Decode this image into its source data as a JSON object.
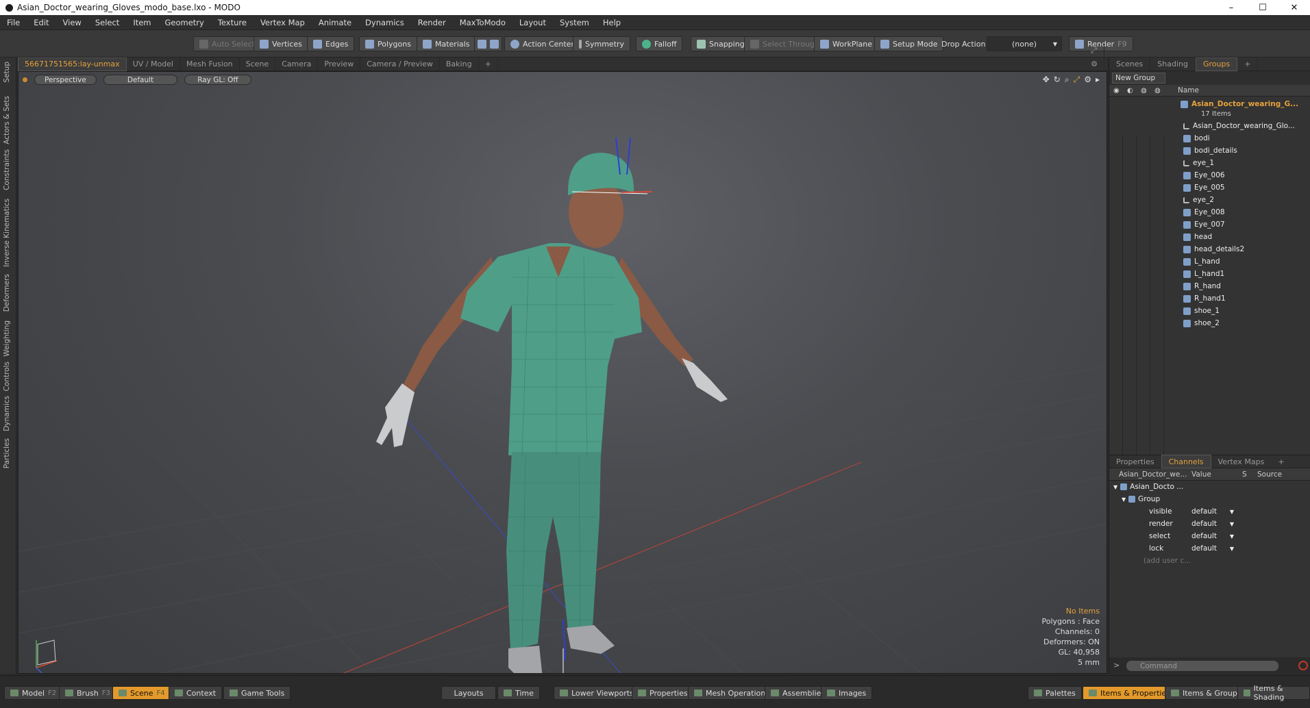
{
  "window": {
    "title": "Asian_Doctor_wearing_Gloves_modo_base.lxo - MODO",
    "min": "–",
    "max": "☐",
    "close": "✕"
  },
  "menu": [
    "File",
    "Edit",
    "View",
    "Select",
    "Item",
    "Geometry",
    "Texture",
    "Vertex Map",
    "Animate",
    "Dynamics",
    "Render",
    "MaxToModo",
    "Layout",
    "System",
    "Help"
  ],
  "toolbar": {
    "auto_select": "Auto Select",
    "vertices": "Vertices",
    "edges": "Edges",
    "polygons": "Polygons",
    "materials": "Materials",
    "action_center": "Action Center",
    "symmetry": "Symmetry",
    "falloff": "Falloff",
    "snapping": "Snapping",
    "select_through": "Select Through",
    "workplane": "WorkPlane",
    "setup_mode": "Setup Mode",
    "drop_action": "Drop Action",
    "drop_value": "(none)",
    "render": "Render",
    "render_key": "F9"
  },
  "left_strip": [
    "Setup",
    "Actors & Sets",
    "Constraints",
    "Inverse Kinematics",
    "Deformers",
    "Weighting",
    "Controls",
    "Dynamics",
    "Particles"
  ],
  "viewport_tabs": [
    "56671751565:lay-unmax",
    "UV / Model",
    "Mesh Fusion",
    "Scene",
    "Camera",
    "Preview",
    "Camera / Preview",
    "Baking",
    "+"
  ],
  "viewport": {
    "view": "Perspective",
    "shading": "Default",
    "raygl": "Ray GL: Off",
    "info": {
      "items": "No Items",
      "polygons": "Polygons : Face",
      "channels": "Channels: 0",
      "deformers": "Deformers: ON",
      "gl": "GL: 40,958",
      "scale": "5 mm"
    }
  },
  "right_tabs": [
    "Scenes",
    "Shading",
    "Groups",
    "+"
  ],
  "groups": {
    "new_group": "New Group",
    "col_name": "Name",
    "root": "Asian_Doctor_wearing_G...",
    "root_count": "17 Items",
    "items": [
      "Asian_Doctor_wearing_Glo...",
      "bodi",
      "bodi_details",
      "eye_1",
      "Eye_006",
      "Eye_005",
      "eye_2",
      "Eye_008",
      "Eye_007",
      "head",
      "head_details2",
      "L_hand",
      "L_hand1",
      "R_hand",
      "R_hand1",
      "shoe_1",
      "shoe_2"
    ]
  },
  "channel_tabs": [
    "Properties",
    "Channels",
    "Vertex Maps",
    "+"
  ],
  "channels": {
    "col_name": "Asian_Doctor_we...",
    "col_value": "Value",
    "col_s": "S",
    "col_source": "Source",
    "item": "Asian_Docto ...",
    "group": "Group",
    "rows": [
      {
        "name": "visible",
        "value": "default"
      },
      {
        "name": "render",
        "value": "default"
      },
      {
        "name": "select",
        "value": "default"
      },
      {
        "name": "lock",
        "value": "default"
      }
    ],
    "add_user": "(add user c..."
  },
  "command_placeholder": "Command",
  "bottom": {
    "model": "Model",
    "model_key": "F2",
    "brush": "Brush",
    "brush_key": "F3",
    "scene": "Scene",
    "scene_key": "F4",
    "context": "Context",
    "game_tools": "Game Tools",
    "layouts": "Layouts",
    "time": "Time",
    "lower_viewports": "Lower Viewports",
    "properties": "Properties",
    "mesh_operations": "Mesh Operations",
    "assemblies": "Assemblies",
    "images": "Images",
    "palettes": "Palettes",
    "items_properties": "Items & Properties",
    "items_groups": "Items & Groups",
    "items_shading": "Items & Shading"
  },
  "colors": {
    "accent": "#e6a23c",
    "scrubs": "#4f9e88"
  }
}
